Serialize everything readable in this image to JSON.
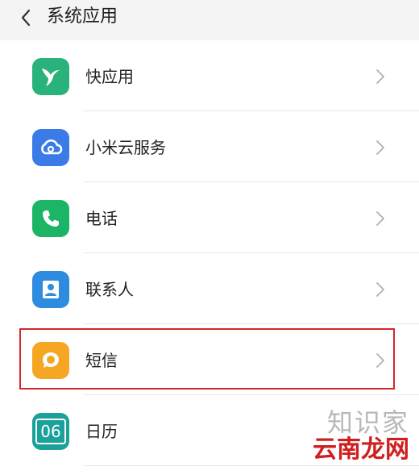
{
  "header": {
    "title": "系统应用",
    "back_icon": "chevron-left-icon"
  },
  "items": [
    {
      "id": "quick-app",
      "label": "快应用",
      "icon": "hummingbird-icon",
      "icon_color": "#2ab27b"
    },
    {
      "id": "mi-cloud",
      "label": "小米云服务",
      "icon": "cloud-icon",
      "icon_color": "#3a7be8"
    },
    {
      "id": "phone",
      "label": "电话",
      "icon": "phone-icon",
      "icon_color": "#1cb565"
    },
    {
      "id": "contacts",
      "label": "联系人",
      "icon": "contact-person-icon",
      "icon_color": "#2d8ce0"
    },
    {
      "id": "messages",
      "label": "短信",
      "icon": "chat-bubble-icon",
      "icon_color": "#f5a623",
      "highlighted": true
    },
    {
      "id": "calendar",
      "label": "日历",
      "icon": "calendar-icon",
      "icon_color": "#1aa19a",
      "icon_text": "06"
    }
  ],
  "highlight_color": "#d6252b",
  "watermark": {
    "line1": "知识家",
    "line2": "云南龙网"
  }
}
